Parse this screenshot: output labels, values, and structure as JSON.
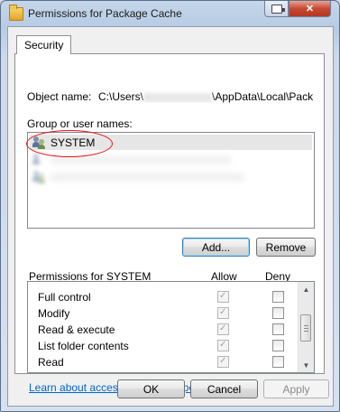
{
  "window": {
    "title": "Permissions for Package Cache",
    "help_icon": "help-icon",
    "close_icon": "close-icon",
    "close_glyph": "✕"
  },
  "tabs": [
    {
      "label": "Security"
    }
  ],
  "object": {
    "label": "Object name:",
    "path_prefix": "C:\\Users\\",
    "path_suffix": "\\AppData\\Local\\Pack"
  },
  "groups": {
    "label": "Group or user names:",
    "items": [
      {
        "label": "SYSTEM",
        "icon": "users-icon"
      }
    ],
    "add_label": "Add...",
    "remove_label": "Remove"
  },
  "permissions": {
    "label": "Permissions for SYSTEM",
    "allow_header": "Allow",
    "deny_header": "Deny",
    "rows": [
      {
        "name": "Full control",
        "allow": true,
        "deny": false
      },
      {
        "name": "Modify",
        "allow": true,
        "deny": false
      },
      {
        "name": "Read & execute",
        "allow": true,
        "deny": false
      },
      {
        "name": "List folder contents",
        "allow": true,
        "deny": false
      },
      {
        "name": "Read",
        "allow": true,
        "deny": false
      }
    ],
    "check_glyph": "✓",
    "scroll_up": "▲",
    "scroll_down": "▼"
  },
  "link": "Learn about access control and permissions",
  "buttons": {
    "ok": "OK",
    "cancel": "Cancel",
    "apply": "Apply"
  },
  "colors": {
    "annotation": "#e01414",
    "link": "#0066cc"
  }
}
